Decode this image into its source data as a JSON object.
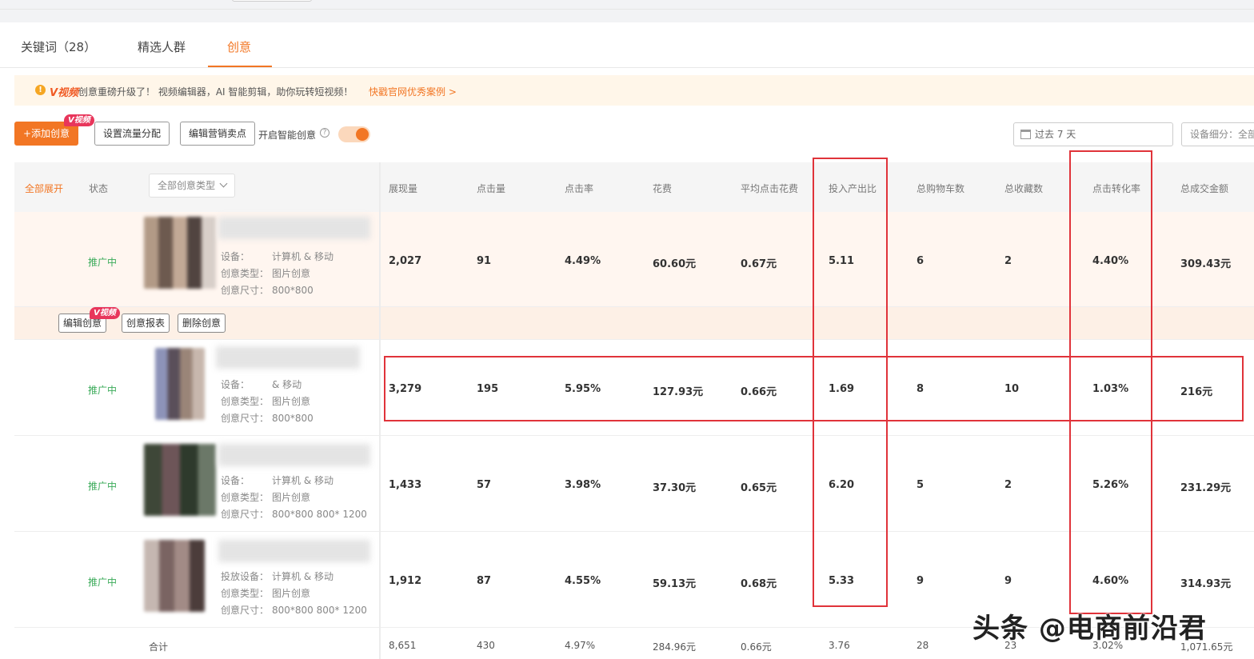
{
  "tabs": [
    {
      "label": "关键词（28）"
    },
    {
      "label": "精选人群"
    },
    {
      "label": "创意",
      "active": true
    }
  ],
  "banner": {
    "tag": "V视频",
    "message": "创意重磅升级了！ 视频编辑器，AI 智能剪辑，助你玩转短视频！",
    "link": "快戳官网优秀案例 >"
  },
  "toolbar": {
    "add_creative": "+添加创意",
    "badge": "V视频",
    "traffic_allocation": "设置流量分配",
    "edit_selling_points": "编辑营销卖点",
    "smart_creative_label": "开启智能创意",
    "smart_creative_on": true,
    "date_range": "过去 7 天",
    "device_filter": "设备细分：全部"
  },
  "table": {
    "expand_all": "全部展开",
    "status_header": "状态",
    "type_filter": "全部创意类型",
    "columns": [
      "展现量",
      "点击量",
      "点击率",
      "花费",
      "平均点击花费",
      "投入产出比",
      "总购物车数",
      "总收藏数",
      "点击转化率",
      "总成交金额"
    ],
    "meta_keys": {
      "device": "设备：",
      "device_full": "投放设备：",
      "type": "创意类型：",
      "size": "创意尺寸："
    },
    "rows": [
      {
        "status": "推广中",
        "device": "计算机 & 移动",
        "type": "图片创意",
        "size": "800*800",
        "values": [
          "2,027",
          "91",
          "4.49%",
          "60.60元",
          "0.67元",
          "5.11",
          "6",
          "2",
          "4.40%",
          "309.43元"
        ]
      },
      {
        "status": "推广中",
        "device": "& 移动",
        "type": "图片创意",
        "size": "800*800",
        "values": [
          "3,279",
          "195",
          "5.95%",
          "127.93元",
          "0.66元",
          "1.69",
          "8",
          "10",
          "1.03%",
          "216元"
        ]
      },
      {
        "status": "推广中",
        "device": "计算机 & 移动",
        "type": "图片创意",
        "size": "800*800 800* 1200",
        "values": [
          "1,433",
          "57",
          "3.98%",
          "37.30元",
          "0.65元",
          "6.20",
          "5",
          "2",
          "5.26%",
          "231.29元"
        ]
      },
      {
        "status": "推广中",
        "device": "计算机 & 移动",
        "type": "图片创意",
        "size": "800*800 800* 1200",
        "values": [
          "1,912",
          "87",
          "4.55%",
          "59.13元",
          "0.68元",
          "5.33",
          "9",
          "9",
          "4.60%",
          "314.93元"
        ]
      }
    ],
    "row_actions": [
      "编辑创意",
      "创意报表",
      "删除创意"
    ],
    "total": {
      "label": "合计",
      "values": [
        "8,651",
        "430",
        "4.97%",
        "284.96元",
        "0.66元",
        "3.76",
        "28",
        "23",
        "3.02%",
        "1,071.65元"
      ]
    }
  },
  "watermark": "头条 @电商前沿君",
  "colors": {
    "accent": "#f27624",
    "status_green": "#3bab5a",
    "highlight_red": "#e0333a",
    "banner_bg": "#fff6e9"
  }
}
